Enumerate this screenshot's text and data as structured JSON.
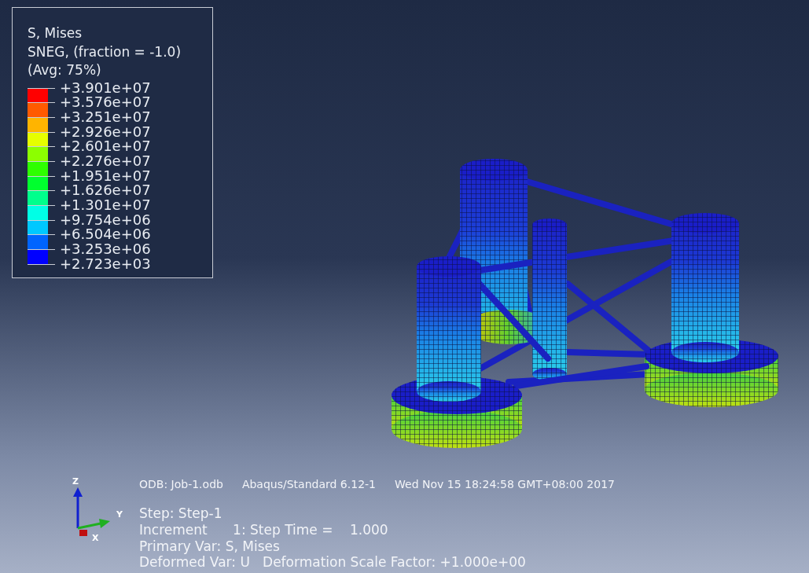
{
  "legend": {
    "title_lines": [
      "S, Mises",
      "SNEG, (fraction = -1.0)",
      "(Avg: 75%)"
    ],
    "bands": [
      {
        "color": "#ff0000"
      },
      {
        "color": "#ff5a00"
      },
      {
        "color": "#ffb400"
      },
      {
        "color": "#e6ff00"
      },
      {
        "color": "#8cff00"
      },
      {
        "color": "#2eff00"
      },
      {
        "color": "#00ff2e"
      },
      {
        "color": "#00ff8c"
      },
      {
        "color": "#00ffe6"
      },
      {
        "color": "#00c8ff"
      },
      {
        "color": "#0064ff"
      },
      {
        "color": "#0000ff"
      }
    ],
    "tick_labels": [
      "+3.901e+07",
      "+3.576e+07",
      "+3.251e+07",
      "+2.926e+07",
      "+2.601e+07",
      "+2.276e+07",
      "+1.951e+07",
      "+1.626e+07",
      "+1.301e+07",
      "+9.754e+06",
      "+6.504e+06",
      "+3.253e+06",
      "+2.723e+03"
    ]
  },
  "triad": {
    "axes": [
      "Z",
      "Y",
      "X"
    ]
  },
  "info": {
    "header": [
      "ODB: Job-1.odb",
      "Abaqus/Standard 6.12-1",
      "Wed Nov 15 18:24:58 GMT+08:00 2017"
    ],
    "lines": [
      "Step: Step-1",
      "Increment      1: Step Time =    1.000",
      "Primary Var: S, Mises",
      "Deformed Var: U   Deformation Scale Factor: +1.000e+00"
    ]
  }
}
